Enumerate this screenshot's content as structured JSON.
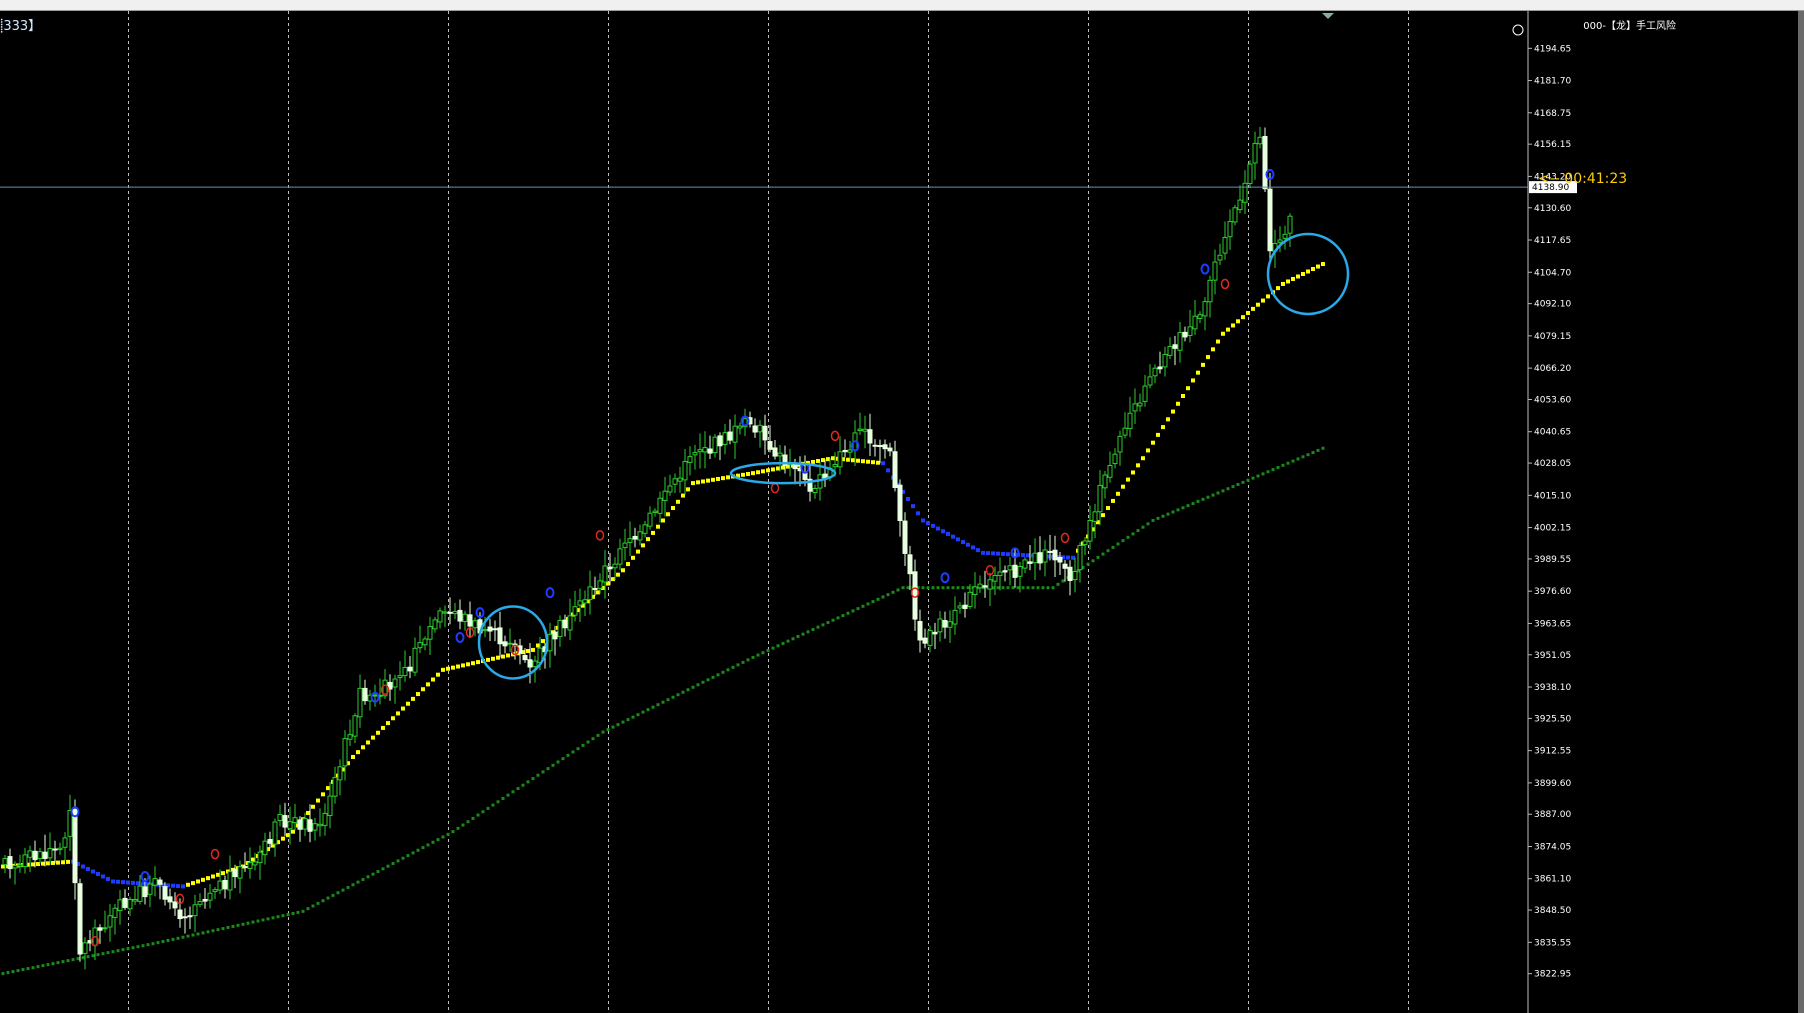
{
  "window": {
    "symbol_label": "⸽333】",
    "indicator_title": "000-【龙】手工风险",
    "countdown": "<-- 00:41:23",
    "smiley_icon": "smiley-icon"
  },
  "colors": {
    "background": "#000000",
    "grid": "#bfbfbf",
    "candle_bull": "#2ecc2e",
    "candle_bear": "#e8ffe0",
    "ma_fast": "#ffff00",
    "ma_fast_down": "#1e3cff",
    "ma_slow": "#1a8a1a",
    "signal_buy": "#1e3cff",
    "signal_sell": "#e0281e",
    "highlight": "#29a9e8",
    "price_line": "#6b8fb3",
    "countdown": "#ffcc00"
  },
  "chart_data": {
    "type": "candlestick",
    "ylim": [
      3816,
      4200
    ],
    "y_ticks": [
      "4194.65",
      "4181.70",
      "4168.75",
      "4156.15",
      "4143.20",
      "4130.60",
      "4117.65",
      "4104.70",
      "4092.10",
      "4079.15",
      "4066.20",
      "4053.60",
      "4040.65",
      "4028.05",
      "4015.10",
      "4002.15",
      "3989.55",
      "3976.60",
      "3963.65",
      "3951.05",
      "3938.10",
      "3925.50",
      "3912.55",
      "3899.60",
      "3887.00",
      "3874.05",
      "3861.10",
      "3848.50",
      "3835.55",
      "3822.95"
    ],
    "current_price": "4138.90",
    "bars": 258,
    "anchors": [
      [
        0,
        3866
      ],
      [
        12,
        3874
      ],
      [
        14,
        3886
      ],
      [
        16,
        3832
      ],
      [
        25,
        3852
      ],
      [
        32,
        3860
      ],
      [
        36,
        3843
      ],
      [
        52,
        3872
      ],
      [
        56,
        3884
      ],
      [
        64,
        3882
      ],
      [
        72,
        3935
      ],
      [
        80,
        3940
      ],
      [
        88,
        3970
      ],
      [
        99,
        3960
      ],
      [
        106,
        3948
      ],
      [
        112,
        3962
      ],
      [
        124,
        3992
      ],
      [
        138,
        4030
      ],
      [
        150,
        4045
      ],
      [
        162,
        4018
      ],
      [
        172,
        4040
      ],
      [
        178,
        4033
      ],
      [
        184,
        3955
      ],
      [
        196,
        3978
      ],
      [
        210,
        3992
      ],
      [
        214,
        3980
      ],
      [
        222,
        4030
      ],
      [
        230,
        4062
      ],
      [
        240,
        4090
      ],
      [
        252,
        4160
      ],
      [
        254,
        4112
      ],
      [
        258,
        4125
      ]
    ],
    "ma_fast": [
      [
        0,
        3866
      ],
      [
        14,
        3868
      ],
      [
        22,
        3860
      ],
      [
        36,
        3858
      ],
      [
        48,
        3866
      ],
      [
        58,
        3880
      ],
      [
        70,
        3910
      ],
      [
        88,
        3945
      ],
      [
        106,
        3953
      ],
      [
        124,
        3985
      ],
      [
        138,
        4020
      ],
      [
        150,
        4024
      ],
      [
        166,
        4030
      ],
      [
        176,
        4028
      ],
      [
        184,
        4005
      ],
      [
        196,
        3992
      ],
      [
        214,
        3990
      ],
      [
        228,
        4030
      ],
      [
        244,
        4080
      ],
      [
        256,
        4100
      ],
      [
        264,
        4108
      ]
    ],
    "ma_fast_down_segments": [
      [
        14,
        36
      ],
      [
        176,
        214
      ]
    ],
    "ma_slow": [
      [
        0,
        3823
      ],
      [
        30,
        3835
      ],
      [
        60,
        3848
      ],
      [
        90,
        3880
      ],
      [
        120,
        3920
      ],
      [
        150,
        3950
      ],
      [
        180,
        3978
      ],
      [
        210,
        3978
      ],
      [
        230,
        4005
      ],
      [
        250,
        4022
      ],
      [
        264,
        4034
      ]
    ],
    "buy_signals": [
      [
        14,
        3888
      ],
      [
        28,
        3862
      ],
      [
        74,
        3934
      ],
      [
        91,
        3958
      ],
      [
        95,
        3968
      ],
      [
        109,
        3976
      ],
      [
        148,
        4045
      ],
      [
        160,
        4026
      ],
      [
        170,
        4035
      ],
      [
        188,
        3982
      ],
      [
        202,
        3992
      ],
      [
        240,
        4106
      ],
      [
        253,
        4144
      ]
    ],
    "sell_signals": [
      [
        18,
        3836
      ],
      [
        35,
        3853
      ],
      [
        42,
        3871
      ],
      [
        76,
        3937
      ],
      [
        93,
        3960
      ],
      [
        102,
        3953
      ],
      [
        119,
        3999
      ],
      [
        154,
        4018
      ],
      [
        166,
        4039
      ],
      [
        182,
        3976
      ],
      [
        197,
        3985
      ],
      [
        212,
        3998
      ],
      [
        244,
        4100
      ]
    ],
    "highlight_circles": [
      {
        "center_bar": 102,
        "center_price": 3956,
        "label": "support-touch-1"
      },
      {
        "center_bar": 156,
        "center_price": 4024,
        "label": "support-touch-2"
      },
      {
        "center_bar": 261,
        "center_price": 4104,
        "label": "support-touch-3"
      }
    ],
    "vertical_grid_bars": [
      25,
      57,
      89,
      121,
      153,
      185,
      217,
      249,
      281
    ]
  }
}
